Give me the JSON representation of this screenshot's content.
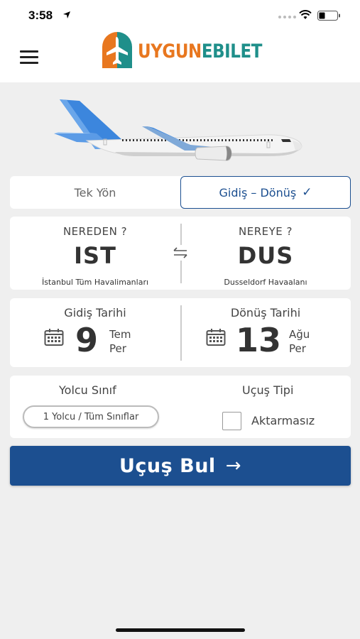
{
  "status": {
    "time": "3:58"
  },
  "header": {
    "logo_part1": "UYGUN",
    "logo_part2": "EBILET"
  },
  "trip_type": {
    "one_way": "Tek Yön",
    "round_trip": "Gidiş – Dönüş",
    "selected": "round_trip",
    "check_mark": "✓"
  },
  "route": {
    "from": {
      "label": "NEREDEN ?",
      "code": "IST",
      "airport": "İstanbul Tüm Havalimanları"
    },
    "to": {
      "label": "NEREYE ?",
      "code": "DUS",
      "airport": "Dusseldorf Havaalanı"
    }
  },
  "dates": {
    "departure": {
      "label": "Gidiş Tarihi",
      "day": "9",
      "month": "Tem",
      "weekday": "Per"
    },
    "return": {
      "label": "Dönüş Tarihi",
      "day": "13",
      "month": "Ağu",
      "weekday": "Per"
    }
  },
  "passengers": {
    "label": "Yolcu Sınıf",
    "value": "1 Yolcu / Tüm Sınıflar"
  },
  "flight_type": {
    "label": "Uçuş Tipi",
    "direct_label": "Aktarmasız",
    "direct_checked": false
  },
  "search": {
    "label": "Uçuş Bul",
    "arrow": "→"
  },
  "colors": {
    "primary": "#1c4f90",
    "logo_orange": "#e8771f",
    "logo_teal": "#1f8f8a",
    "background": "#efefef"
  },
  "icons": [
    "location-arrow-icon",
    "wifi-icon",
    "battery-icon",
    "menu-icon",
    "plane-logo-icon",
    "swap-icon",
    "calendar-icon",
    "check-icon",
    "arrow-right-icon"
  ]
}
